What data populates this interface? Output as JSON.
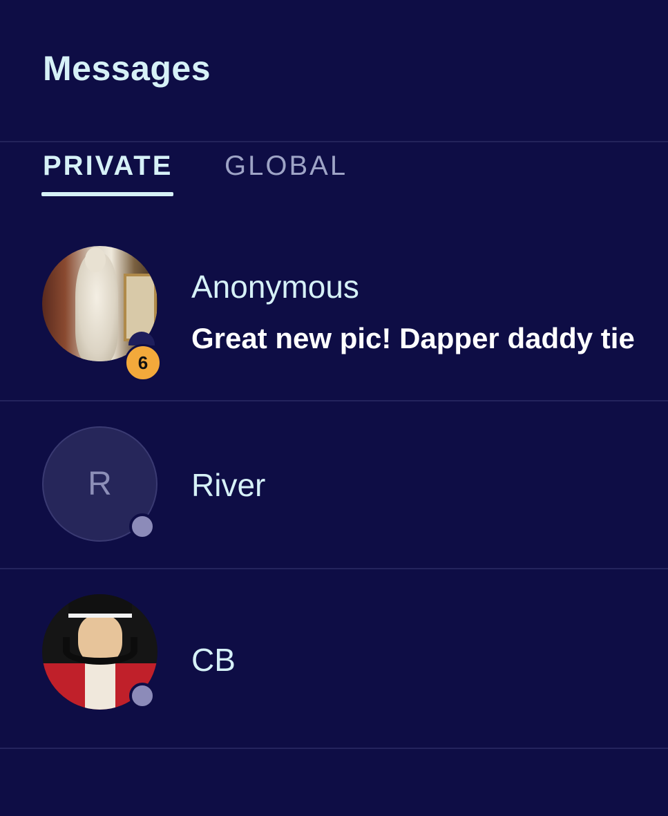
{
  "header": {
    "title": "Messages"
  },
  "tabs": [
    {
      "label": "PRIVATE",
      "active": true
    },
    {
      "label": "GLOBAL",
      "active": false
    }
  ],
  "conversations": [
    {
      "name": "Anonymous",
      "preview": "Great new pic! Dapper daddy tie",
      "unread_count": "6",
      "avatar": "statue-photo"
    },
    {
      "name": "River",
      "initial": "R",
      "status": "offline",
      "avatar": "initial-letter"
    },
    {
      "name": "CB",
      "status": "offline",
      "avatar": "mustache-cartoon-photo"
    }
  ],
  "colors": {
    "background": "#0e0d45",
    "text": "#d6f1f7",
    "inactive_tab": "#9ea4c6",
    "unread_badge": "#f3a93b",
    "status_dot": "#8c8bb9"
  }
}
